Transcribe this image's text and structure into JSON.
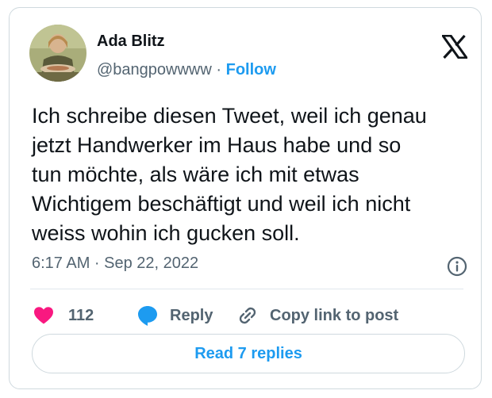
{
  "author": {
    "name": "Ada Blitz",
    "handle": "@bangpowwww",
    "separator": "·",
    "follow_label": "Follow"
  },
  "tweet": {
    "text_lines": [
      "Ich schreibe diesen Tweet, weil ich genau",
      "jetzt Handwerker im Haus habe und so",
      "tun möchte, als wäre ich mit etwas",
      "Wichtigem beschäftigt und weil ich nicht",
      "weiss wohin ich gucken soll."
    ],
    "timestamp": "6:17 AM · Sep 22, 2022"
  },
  "actions": {
    "like_count": "112",
    "reply_label": "Reply",
    "copy_label": "Copy link to post"
  },
  "read_replies_label": "Read 7 replies",
  "icons": {
    "logo": "x-logo-icon",
    "info": "info-icon",
    "like": "heart-icon",
    "reply": "speech-bubble-icon",
    "copy": "link-icon"
  },
  "colors": {
    "accent": "#1d9bf0",
    "like": "#f91880",
    "secondary_text": "#536471",
    "primary_text": "#0f1419"
  }
}
